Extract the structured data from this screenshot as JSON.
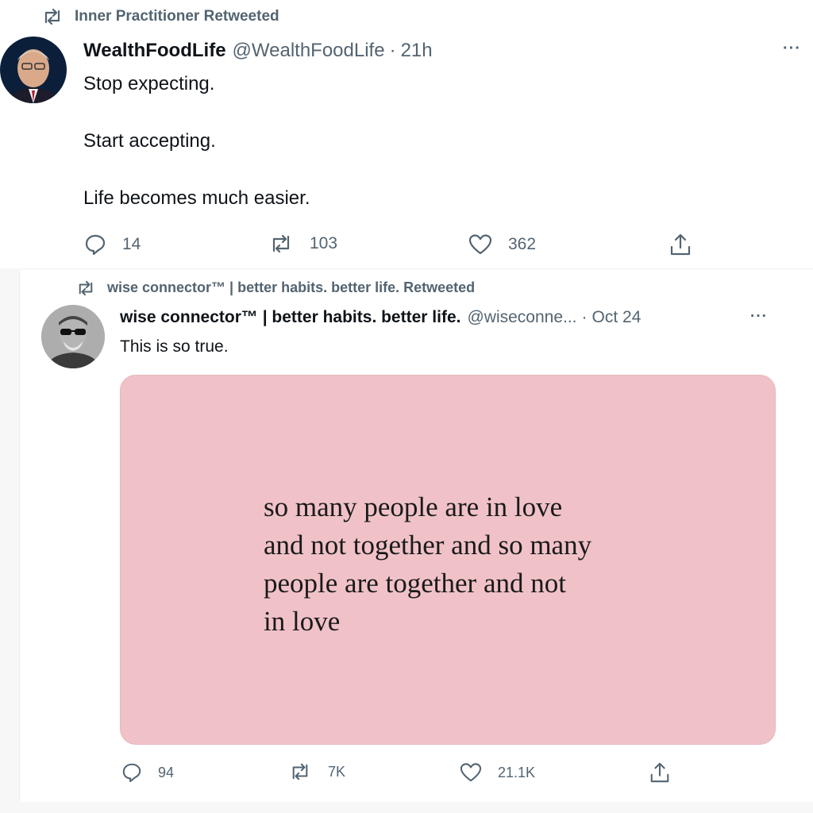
{
  "tweets": [
    {
      "retweeted_by": "Inner Practitioner Retweeted",
      "author_name": "WealthFoodLife",
      "handle": "@WealthFoodLife",
      "separator": "·",
      "time": "21h",
      "more": "···",
      "text_lines": [
        "Stop expecting.",
        "Start accepting.",
        "Life becomes much easier."
      ],
      "replies": "14",
      "retweets": "103",
      "likes": "362"
    },
    {
      "retweeted_by": "wise connector™ | better habits. better life. Retweeted",
      "author_name": "wise connector™ | better habits. better life.",
      "handle": "@wiseconne...",
      "separator": "·",
      "time": "Oct 24",
      "more": "···",
      "text_lines": [
        "This is so true."
      ],
      "media_quote_lines": [
        "so many people are in love",
        "and not together and so many",
        "people are together and not",
        "in love"
      ],
      "media_background": "#f0c2c7",
      "replies": "94",
      "retweets": "7K",
      "likes": "21.1K"
    }
  ],
  "icons": {
    "retweet": "retweet-icon",
    "reply": "reply-icon",
    "like": "heart-icon",
    "share": "share-icon"
  },
  "colors": {
    "text": "#0f1419",
    "secondary": "#536471"
  }
}
